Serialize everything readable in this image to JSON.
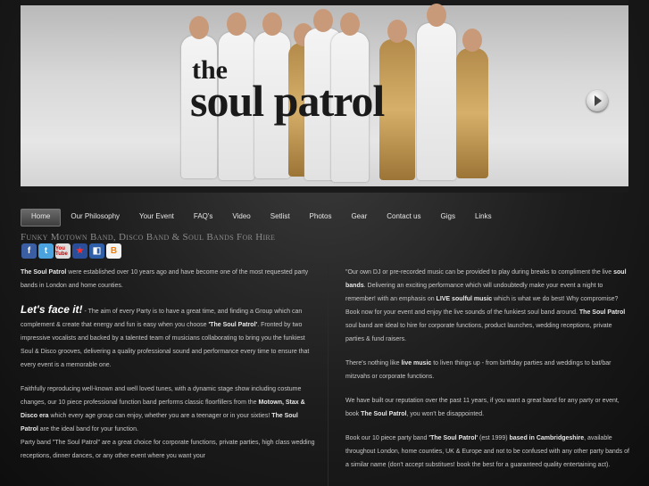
{
  "banner": {
    "logo_the": "the",
    "logo_name": "soul patrol"
  },
  "nav": {
    "items": [
      "Home",
      "Our Philosophy",
      "Your Event",
      "FAQ's",
      "Video",
      "Setlist",
      "Photos",
      "Gear",
      "Contact us",
      "Gigs",
      "Links"
    ],
    "active": "Home"
  },
  "tagline": "Funky Motown Band, Disco Band & Soul Bands For Hire",
  "social": [
    {
      "icon": "facebook-icon",
      "glyph": "f"
    },
    {
      "icon": "twitter-icon",
      "glyph": "t"
    },
    {
      "icon": "youtube-icon",
      "glyph": "You Tube"
    },
    {
      "icon": "myspace-icon",
      "glyph": "★"
    },
    {
      "icon": "delicious-icon",
      "glyph": "◧"
    },
    {
      "icon": "blogger-icon",
      "glyph": "B"
    }
  ],
  "left": {
    "p1_b": "The Soul Patrol",
    "p1": " were established over 10 years ago and have become one of the most requested party bands in London and home counties.",
    "p2_lead": "Let's face it!",
    "p2_a": " - The aim of every Party is to have a great time, and finding a Group which can complement & create that energy and fun is easy when you choose ",
    "p2_b": "'The Soul Patrol'",
    "p2_c": ". Fronted by two impressive vocalists and backed by a talented team of musicians collaborating to bring you the funkiest Soul & Disco grooves, delivering a quality professional sound and performance every time to ensure that every event is a memorable one.",
    "p3_a": "Faithfully reproducing well-known and well loved tunes, with a dynamic stage show including costume changes, our 10 piece professional function band performs classic floorfillers from the ",
    "p3_b": "Motown, Stax & Disco era",
    "p3_c": " which every age group can enjoy, whether you are a teenager or in your sixties! ",
    "p3_d": "The Soul Patrol",
    "p3_e": " are the ideal band for your function.",
    "p4": "Party band \"The Soul Patrol\" are a great choice for corporate functions, private parties, high class wedding receptions, dinner dances, or any other event where you want your"
  },
  "right": {
    "p1_a": "\"Our own DJ or pre-recorded music can be provided to play during breaks to compliment the live ",
    "p1_b": "soul bands",
    "p1_c": ". Delivering an exciting performance which will undoubtedly make your event a night to remember! with an emphasis on ",
    "p1_d": "LIVE soulful music",
    "p1_e": " which is what we do best! Why compromise? Book now for your event and enjoy the live sounds of the funkiest soul band around. ",
    "p1_f": "The Soul Patrol",
    "p1_g": " soul band are ideal to hire for corporate functions, product launches, wedding receptions, private parties & fund raisers.",
    "p2_a": "There's nothing like ",
    "p2_b": "live music",
    "p2_c": " to liven things up - from birthday parties and weddings to bat/bar mitzvahs or corporate functions.",
    "p3_a": "We have built our reputation over the past 11 years, if you want a great band for any party or event, book ",
    "p3_b": "The Soul Patrol",
    "p3_c": ", you won't be disappointed.",
    "p4_a": "Book our 10 piece party band ",
    "p4_b": "'The Soul Patrol'",
    "p4_c": " (est 1999) ",
    "p4_d": "based in Cambridgeshire",
    "p4_e": ", available throughout London, home counties, UK & Europe and not to be confused with any other party bands of a similar name (don't accept substitues! book the best for a guaranteed quality entertaining act)."
  }
}
